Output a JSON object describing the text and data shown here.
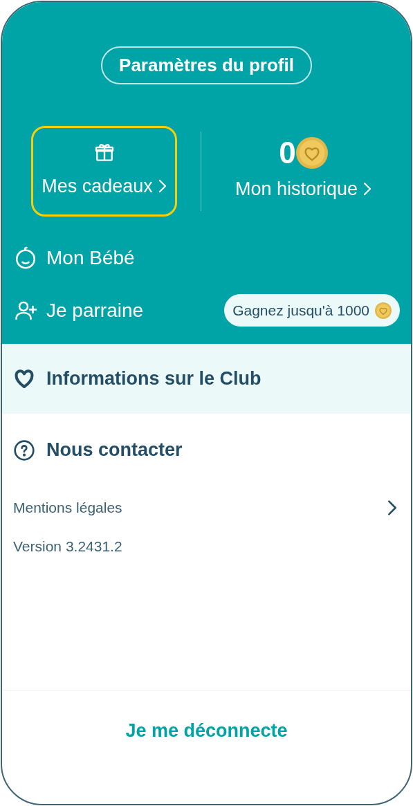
{
  "header": {
    "title": "Paramètres du profil"
  },
  "tiles": [
    {
      "kind": "gifts",
      "label": "Mes cadeaux",
      "selected": true
    },
    {
      "kind": "history",
      "value": "0",
      "label": "Mon historique",
      "selected": false
    }
  ],
  "menu": [
    {
      "kind": "baby",
      "label": "Mon Bébé"
    },
    {
      "kind": "referral",
      "label": "Je parraine",
      "badge": "Gagnez jusqu'à 1000"
    }
  ],
  "club": {
    "label": "Informations sur le Club"
  },
  "contact": {
    "label": "Nous contacter"
  },
  "legal": {
    "label": "Mentions légales"
  },
  "version": "Version 3.2431.2",
  "logout": "Je me déconnecte"
}
